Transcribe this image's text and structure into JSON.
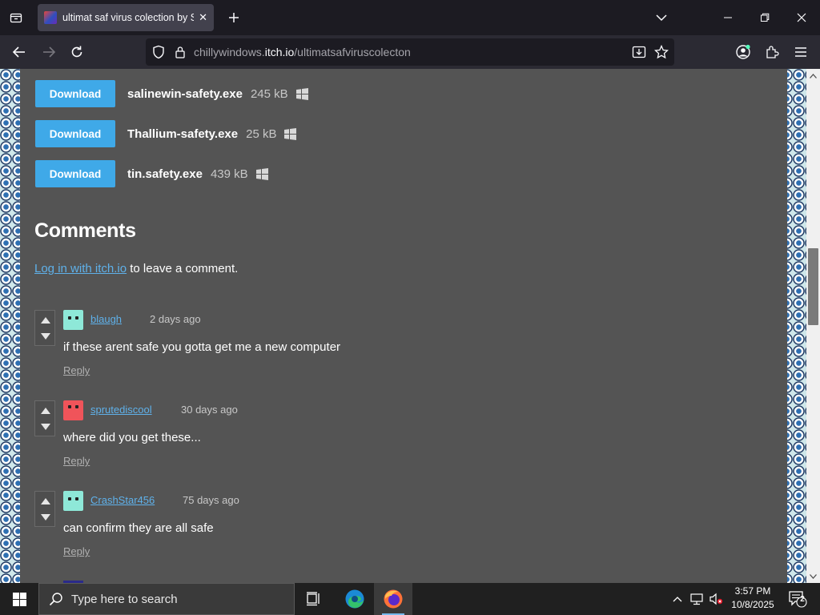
{
  "browser": {
    "tab_title": "ultimat saf virus colection by Si",
    "url_prefix": "chillywindows.",
    "url_host": "itch.io",
    "url_path": "/ultimatsafviruscolecton"
  },
  "downloads": [
    {
      "button": "Download",
      "name": "salinewin-safety.exe",
      "size": "245 kB"
    },
    {
      "button": "Download",
      "name": "Thallium-safety.exe",
      "size": "25 kB"
    },
    {
      "button": "Download",
      "name": "tin.safety.exe",
      "size": "439 kB"
    }
  ],
  "comments_section": {
    "heading": "Comments",
    "login_link": "Log in with itch.io",
    "login_suffix": " to leave a comment."
  },
  "comments": [
    {
      "user": "blaugh",
      "time": "2 days ago",
      "body": "if these arent safe you gotta get me a new computer",
      "reply": "Reply",
      "avatar_color": "#8ee8d8"
    },
    {
      "user": "sprutediscool",
      "time": "30 days ago",
      "body": "where did you get these...",
      "reply": "Reply",
      "avatar_color": "#f0545a"
    },
    {
      "user": "CrashStar456",
      "time": "75 days ago",
      "body": "can confirm they are all safe",
      "reply": "Reply",
      "avatar_color": "#8ee8d8"
    }
  ],
  "taskbar": {
    "search_placeholder": "Type here to search",
    "time": "3:57 PM",
    "date": "10/8/2025",
    "notification_count": "2"
  },
  "colors": {
    "download_button": "#3fa9e8",
    "link": "#5fb1ea",
    "page_background": "#545454"
  },
  "icons": [
    "tab-list-icon",
    "close-icon",
    "plus-icon",
    "chevron-down-icon",
    "minimize-icon",
    "maximize-icon",
    "back-arrow-icon",
    "forward-arrow-icon",
    "reload-icon",
    "shield-icon",
    "lock-icon",
    "save-to-pocket-icon",
    "star-icon",
    "account-icon",
    "extensions-icon",
    "menu-icon",
    "windows-logo-icon",
    "upvote-icon",
    "downvote-icon",
    "search-icon",
    "task-view-icon",
    "edge-icon",
    "firefox-icon",
    "network-icon",
    "volume-muted-icon",
    "notification-icon"
  ]
}
